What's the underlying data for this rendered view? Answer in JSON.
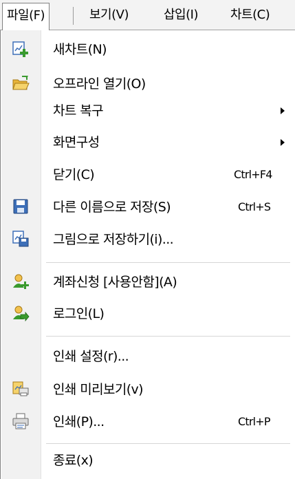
{
  "menubar": {
    "items": [
      {
        "label": "파일(F)"
      },
      {
        "label": "보기(V)"
      },
      {
        "label": "삽입(I)"
      },
      {
        "label": "차트(C)"
      }
    ]
  },
  "menu": {
    "items": [
      {
        "label": "새차트(N)",
        "icon": "new-chart-icon"
      },
      {
        "label": "오프라인 열기(O)",
        "icon": "open-folder-icon"
      },
      {
        "label": "차트 복구",
        "submenu": true
      },
      {
        "label": "화면구성",
        "submenu": true
      },
      {
        "label": "닫기(C)",
        "shortcut": "Ctrl+F4"
      },
      {
        "label": "다른 이름으로 저장(S)",
        "shortcut": "Ctrl+S",
        "icon": "floppy-disk-icon"
      },
      {
        "label": "그림으로 저장하기(i)...",
        "icon": "save-image-icon"
      },
      {
        "label": "계좌신청 [사용안함](A)",
        "icon": "account-request-icon"
      },
      {
        "label": "로그인(L)",
        "icon": "login-icon"
      },
      {
        "label": "인쇄 설정(r)..."
      },
      {
        "label": "인쇄 미리보기(v)",
        "icon": "print-preview-icon"
      },
      {
        "label": "인쇄(P)...",
        "shortcut": "Ctrl+P",
        "icon": "printer-icon"
      },
      {
        "label": "종료(x)"
      }
    ]
  },
  "colors": {
    "menubar_bg": "#f3f3f3",
    "icon_strip_bg": "#f1f1f1",
    "separator": "#d6d6d6",
    "icon_green": "#3a9a2e",
    "icon_blue": "#3d6fb8",
    "icon_folder": "#e8b43a"
  }
}
